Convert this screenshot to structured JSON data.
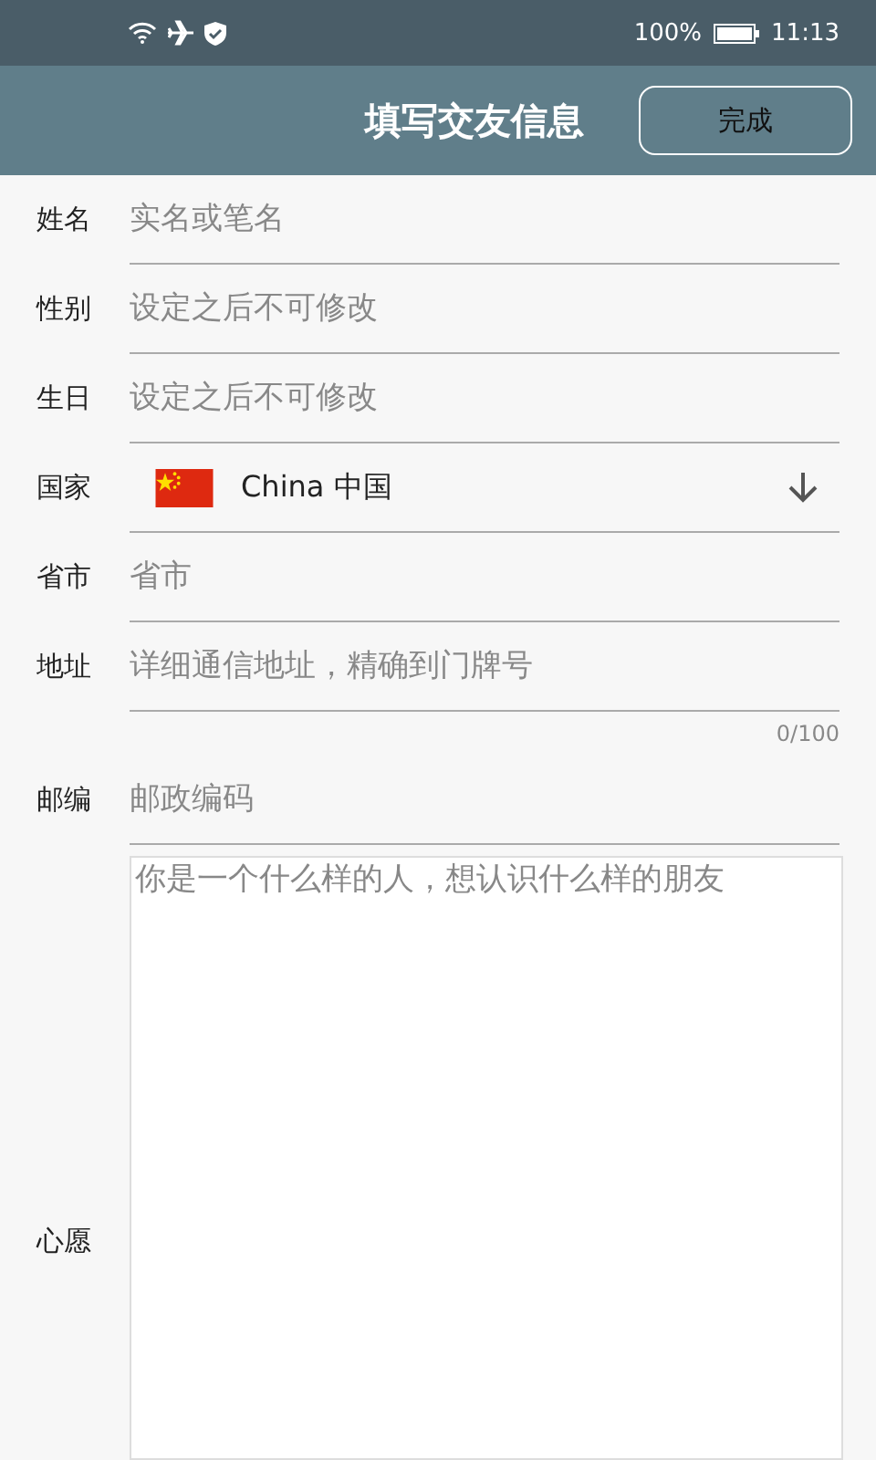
{
  "status_bar": {
    "battery": "100%",
    "time": "11:13"
  },
  "header": {
    "title": "填写交友信息",
    "done_button": "完成"
  },
  "fields": [
    {
      "kind": "text",
      "label": "姓名",
      "placeholder": "实名或笔名"
    },
    {
      "kind": "text",
      "label": "性别",
      "placeholder": "设定之后不可修改"
    },
    {
      "kind": "text",
      "label": "生日",
      "placeholder": "设定之后不可修改"
    },
    {
      "kind": "select",
      "label": "国家",
      "value": "China 中国"
    },
    {
      "kind": "text",
      "label": "省市",
      "placeholder": "省市"
    },
    {
      "kind": "text",
      "label": "地址",
      "placeholder": "详细通信地址，精确到门牌号",
      "counter": "0/100"
    },
    {
      "kind": "text",
      "label": "邮编",
      "placeholder": "邮政编码"
    },
    {
      "kind": "textarea",
      "label": "心愿",
      "placeholder": "你是一个什么样的人，想认识什么样的朋友"
    }
  ]
}
